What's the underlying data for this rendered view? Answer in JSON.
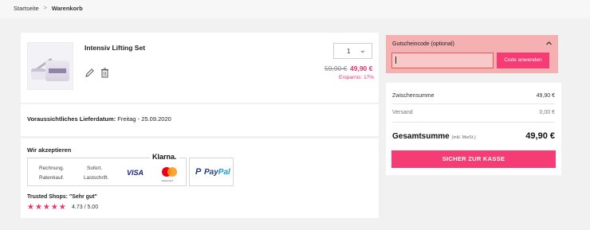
{
  "breadcrumb": {
    "home": "Startseite",
    "separator": ">",
    "current": "Warenkorb"
  },
  "product": {
    "name": "Intensiv Lifting Set",
    "quantity": "1",
    "old_price": "59,90 €",
    "new_price": "49,90 €",
    "savings": "Ersparnis: 17%",
    "edit_icon": "pencil-icon",
    "delete_icon": "trash-icon"
  },
  "delivery": {
    "label": "Voraussichtliches Lieferdatum:",
    "date": "Freitag - 25.09.2020"
  },
  "payment": {
    "heading": "Wir akzeptieren",
    "klarna_logo": "Klarna.",
    "klarna_lines": [
      "Rechnung.",
      "Ratenkauf.",
      "Sofort.",
      "Lastschrift."
    ],
    "visa": "VISA",
    "mastercard_label": "mastercard",
    "paypal": [
      "Pay",
      "Pal"
    ]
  },
  "trusted_shops": {
    "label": "Trusted Shops: \"Sehr gut\"",
    "stars": "★★★★★",
    "rating": "4.73 / 5.00"
  },
  "coupon": {
    "label": "Gutscheincode (optional)",
    "input_value": "",
    "button": "Code anwenden"
  },
  "totals": {
    "subtotal_label": "Zwischensumme",
    "subtotal_value": "49,90 €",
    "shipping_label": "Versand",
    "shipping_value": "0,00 €",
    "grand_label": "Gesamtsumme",
    "grand_note": "(inkl. MwSt.)",
    "grand_value": "49,90 €",
    "checkout_button": "SICHER ZUR KASSE"
  },
  "colors": {
    "accent": "#f53c74",
    "price": "#e8336d",
    "coupon_bg": "#f5b1b1"
  }
}
